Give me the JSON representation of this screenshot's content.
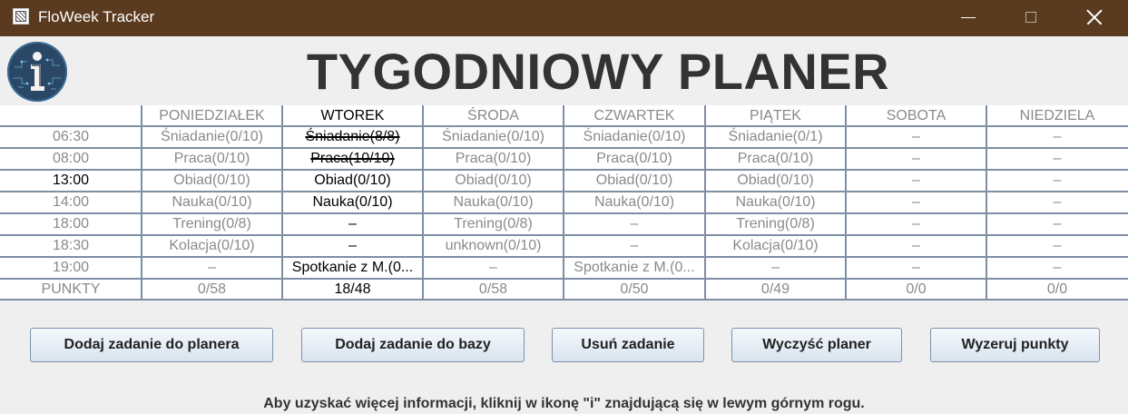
{
  "window": {
    "title": "FloWeek Tracker"
  },
  "header": {
    "title": "TYGODNIOWY PLANER"
  },
  "planner": {
    "days": [
      "PONIEDZIAŁEK",
      "WTOREK",
      "ŚRODA",
      "CZWARTEK",
      "PIĄTEK",
      "SOBOTA",
      "NIEDZIELA"
    ],
    "active_day_index": 1,
    "rows": [
      {
        "time": "06:30",
        "active": false,
        "cells": [
          "Śniadanie(0/10)",
          "Śniadanie(8/8)",
          "Śniadanie(0/10)",
          "Śniadanie(0/10)",
          "Śniadanie(0/1)",
          "–",
          "–"
        ]
      },
      {
        "time": "08:00",
        "active": false,
        "cells": [
          "Praca(0/10)",
          "Praca(10/10)",
          "Praca(0/10)",
          "Praca(0/10)",
          "Praca(0/10)",
          "–",
          "–"
        ]
      },
      {
        "time": "13:00",
        "active": true,
        "cells": [
          "Obiad(0/10)",
          "Obiad(0/10)",
          "Obiad(0/10)",
          "Obiad(0/10)",
          "Obiad(0/10)",
          "–",
          "–"
        ]
      },
      {
        "time": "14:00",
        "active": false,
        "cells": [
          "Nauka(0/10)",
          "Nauka(0/10)",
          "Nauka(0/10)",
          "Nauka(0/10)",
          "Nauka(0/10)",
          "–",
          "–"
        ]
      },
      {
        "time": "18:00",
        "active": false,
        "cells": [
          "Trening(0/8)",
          "–",
          "Trening(0/8)",
          "–",
          "Trening(0/8)",
          "–",
          "–"
        ]
      },
      {
        "time": "18:30",
        "active": false,
        "cells": [
          "Kolacja(0/10)",
          "–",
          "unknown(0/10)",
          "–",
          "Kolacja(0/10)",
          "–",
          "–"
        ]
      },
      {
        "time": "19:00",
        "active": false,
        "cells": [
          "–",
          "Spotkanie z M.(0...",
          "–",
          "Spotkanie z M.(0...",
          "–",
          "–",
          "–"
        ]
      }
    ],
    "struck_cells": [
      [
        0,
        1
      ],
      [
        1,
        1
      ]
    ],
    "points_label": "PUNKTY",
    "points": [
      "0/58",
      "18/48",
      "0/58",
      "0/50",
      "0/49",
      "0/0",
      "0/0"
    ]
  },
  "buttons": {
    "add_to_planner": "Dodaj zadanie do planera",
    "add_to_db": "Dodaj zadanie do bazy",
    "remove_task": "Usuń zadanie",
    "clear_planner": "Wyczyść planer",
    "reset_points": "Wyzeruj punkty"
  },
  "footer": {
    "hint": "Aby uzyskać więcej informacji, kliknij w ikonę \"i\" znajdującą się w lewym górnym rogu."
  },
  "icons": {
    "app": "app-icon",
    "info": "info-icon"
  },
  "colors": {
    "titlebar": "#5a3b1f",
    "grid_line": "#7e8ea3",
    "inactive_text": "#8a8a8a",
    "active_text": "#000000"
  }
}
